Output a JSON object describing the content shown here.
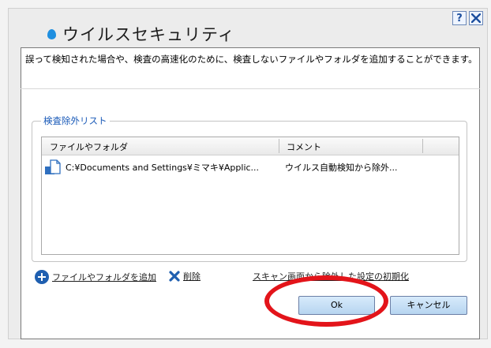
{
  "dialog": {
    "title": "ウイルスセキュリティ",
    "help_label": "?",
    "description": "誤って検知された場合や、検査の高速化のために、検査しないファイルやフォルダを追加することができます。"
  },
  "exclusion_list": {
    "legend": "検査除外リスト",
    "columns": [
      "ファイルやフォルダ",
      "コメント"
    ],
    "rows": [
      {
        "path": "C:¥Documents and Settings¥ミマキ¥Applic...",
        "comment": "ウイルス自動検知から除外..."
      }
    ]
  },
  "actions": {
    "add_label": "ファイルやフォルダを追加",
    "delete_label": "削除",
    "reset_label": "スキャン画面から除外した設定の初期化"
  },
  "buttons": {
    "ok_label": "Ok",
    "cancel_label": "キャンセル"
  },
  "colors": {
    "accent": "#1f8fe0",
    "legend": "#1a5ab8",
    "annotation": "#e3141a"
  }
}
